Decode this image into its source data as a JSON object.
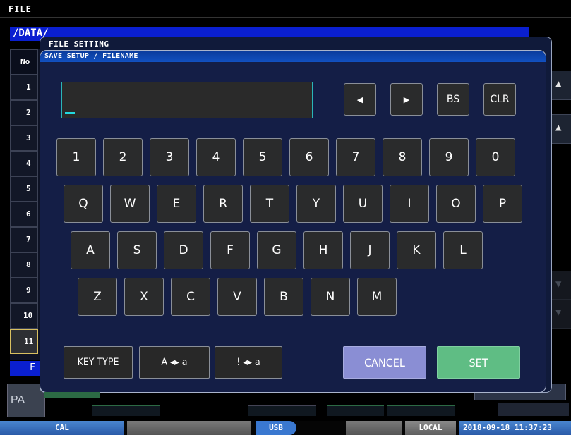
{
  "top_bar": {
    "title": "FILE"
  },
  "path": "/DATA/",
  "list": {
    "header": "No",
    "rows": [
      "1",
      "2",
      "3",
      "4",
      "5",
      "6",
      "7",
      "8",
      "9",
      "10",
      "11"
    ],
    "selected_row": "11",
    "footer_label": "F",
    "page_button": "PA"
  },
  "file_setting": {
    "title": "FILE SETTING",
    "dialog_title": "SAVE SETUP / FILENAME",
    "filename_value": "",
    "controls": {
      "left": "◀",
      "right": "▶",
      "bs": "BS",
      "clr": "CLR"
    },
    "keys": {
      "row1": [
        "1",
        "2",
        "3",
        "4",
        "5",
        "6",
        "7",
        "8",
        "9",
        "0"
      ],
      "row2": [
        "Q",
        "W",
        "E",
        "R",
        "T",
        "Y",
        "U",
        "I",
        "O",
        "P"
      ],
      "row3": [
        "A",
        "S",
        "D",
        "F",
        "G",
        "H",
        "J",
        "K",
        "L"
      ],
      "row4": [
        "Z",
        "X",
        "C",
        "V",
        "B",
        "N",
        "M"
      ]
    },
    "bottom": {
      "key_type": "KEY TYPE",
      "case_toggle": "A ◂▸ a",
      "symbol_toggle": "! ◂▸ a",
      "cancel": "CANCEL",
      "set": "SET"
    },
    "colors": {
      "cancel": "#8a8ed4",
      "set": "#5fbd84",
      "cursor": "#22d8e0",
      "title_bar": "#1250c0"
    }
  },
  "status_bar": {
    "cal": "CAL",
    "usb": "USB",
    "local": "LOCAL",
    "datetime": "2018-09-18 11:37:23"
  }
}
